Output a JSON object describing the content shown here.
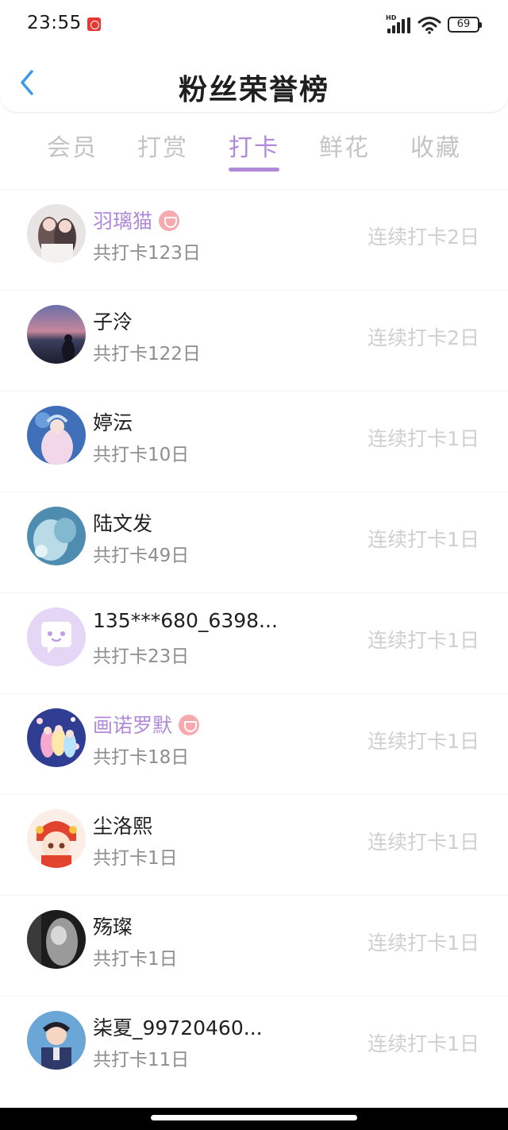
{
  "status_bar": {
    "time": "23:55",
    "network": "HD",
    "battery": "69",
    "icons": [
      "app-notification-icon",
      "signal-icon",
      "wifi-icon",
      "battery-icon"
    ]
  },
  "header": {
    "title": "粉丝荣誉榜",
    "back_icon": "chevron-left-icon"
  },
  "tabs": [
    {
      "label": "会员",
      "active": false
    },
    {
      "label": "打赏",
      "active": false
    },
    {
      "label": "打卡",
      "active": true
    },
    {
      "label": "鲜花",
      "active": false
    },
    {
      "label": "收藏",
      "active": false
    }
  ],
  "colors": {
    "accent": "#b08ad8",
    "inactive_tab": "#c4c4c4",
    "streak_text": "#cfcfcf",
    "badge": "#f7a9ad"
  },
  "fans": [
    {
      "name": "羽璃猫",
      "vip": true,
      "total": "共打卡123日",
      "streak": "连续打卡2日",
      "avatar": "avatar-image"
    },
    {
      "name": "子泠",
      "vip": false,
      "total": "共打卡122日",
      "streak": "连续打卡2日",
      "avatar": "avatar-image"
    },
    {
      "name": "婷沄",
      "vip": false,
      "total": "共打卡10日",
      "streak": "连续打卡1日",
      "avatar": "avatar-image"
    },
    {
      "name": "陆文发",
      "vip": false,
      "total": "共打卡49日",
      "streak": "连续打卡1日",
      "avatar": "avatar-image"
    },
    {
      "name": "135***680_6398...",
      "vip": false,
      "total": "共打卡23日",
      "streak": "连续打卡1日",
      "avatar": "default-avatar-icon"
    },
    {
      "name": "画诺罗默",
      "vip": true,
      "total": "共打卡18日",
      "streak": "连续打卡1日",
      "avatar": "avatar-image"
    },
    {
      "name": "尘洛熙",
      "vip": false,
      "total": "共打卡1日",
      "streak": "连续打卡1日",
      "avatar": "avatar-image"
    },
    {
      "name": "殇璨",
      "vip": false,
      "total": "共打卡1日",
      "streak": "连续打卡1日",
      "avatar": "avatar-image"
    },
    {
      "name": "柒夏_99720460...",
      "vip": false,
      "total": "共打卡11日",
      "streak": "连续打卡1日",
      "avatar": "avatar-image"
    }
  ]
}
